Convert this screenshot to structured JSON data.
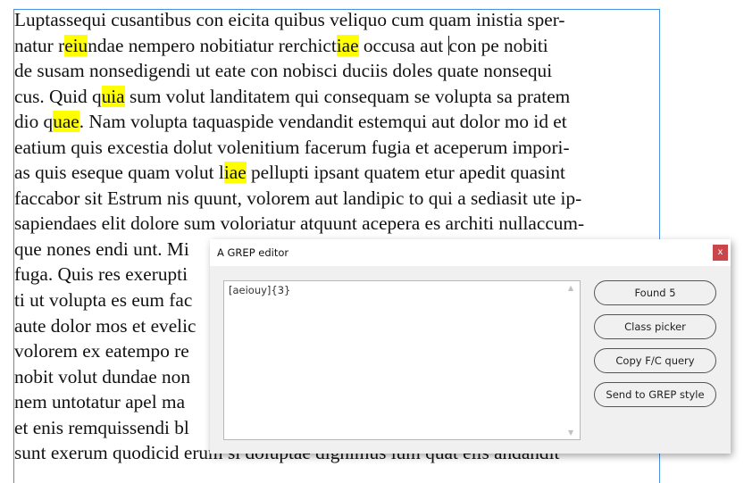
{
  "document": {
    "lines": [
      [
        [
          "Luptassequi cusantibus con eicita quibus veliquo cum quam inistia sper-",
          false
        ]
      ],
      [
        [
          "natur r",
          false
        ],
        [
          "eiu",
          true
        ],
        [
          "ndae nempero nobitiatur rerchict",
          false
        ],
        [
          "iae",
          true
        ],
        [
          " occusa aut ",
          false
        ],
        [
          "|",
          "caret"
        ],
        [
          "con pe nobiti",
          false
        ]
      ],
      [
        [
          "de susam nonsedigendi ut eate con nobisci duciis doles quate nonsequi",
          false
        ]
      ],
      [
        [
          "cus. Quid q",
          false
        ],
        [
          "uia",
          true
        ],
        [
          " sum volut landitatem qui consequam se volupta sa pratem",
          false
        ]
      ],
      [
        [
          "dio q",
          false
        ],
        [
          "uae",
          true
        ],
        [
          ". Nam volupta taquaspide vendandit estemqui aut dolor mo id et",
          false
        ]
      ],
      [
        [
          "eatium quis excestia dolut volenitium facerum fugia et aceperum impori-",
          false
        ]
      ],
      [
        [
          "as quis eseque quam volut l",
          false
        ],
        [
          "iae",
          true
        ],
        [
          " pellupti ipsant quatem etur apedit quasint",
          false
        ]
      ],
      [
        [
          "faccabor sit Estrum nis quunt, volorem aut landipic to qui a sediasit ute ip-",
          false
        ]
      ],
      [
        [
          "sapiendaes elit dolore sum voloriatur atquunt acepera es architi nullaccum-",
          false
        ]
      ],
      [
        [
          "que nones endi unt. Mi",
          false
        ]
      ],
      [
        [
          "fuga. Quis res exerupti",
          false
        ]
      ],
      [
        [
          "ti ut volupta es eum fac",
          false
        ]
      ],
      [
        [
          "aute dolor mos et evelic",
          false
        ]
      ],
      [
        [
          "volorem ex eatempo re",
          false
        ]
      ],
      [
        [
          "nobit volut dundae non",
          false
        ]
      ],
      [
        [
          "nem untotatur apel ma",
          false
        ]
      ],
      [
        [
          "et enis remquissendi bl",
          false
        ]
      ],
      [
        [
          "sunt exerum quodicid erum si doluptae dignimus ium quat elis andandit",
          false
        ]
      ]
    ],
    "highlight_color": "#ffff00"
  },
  "dialog": {
    "title": "A GREP editor",
    "close_label": "x",
    "query": "[aeiouy]{3}",
    "buttons": {
      "found": "Found 5",
      "class_picker": "Class picker",
      "copy_query": "Copy F/C query",
      "send_grep": "Send to GREP style"
    }
  }
}
